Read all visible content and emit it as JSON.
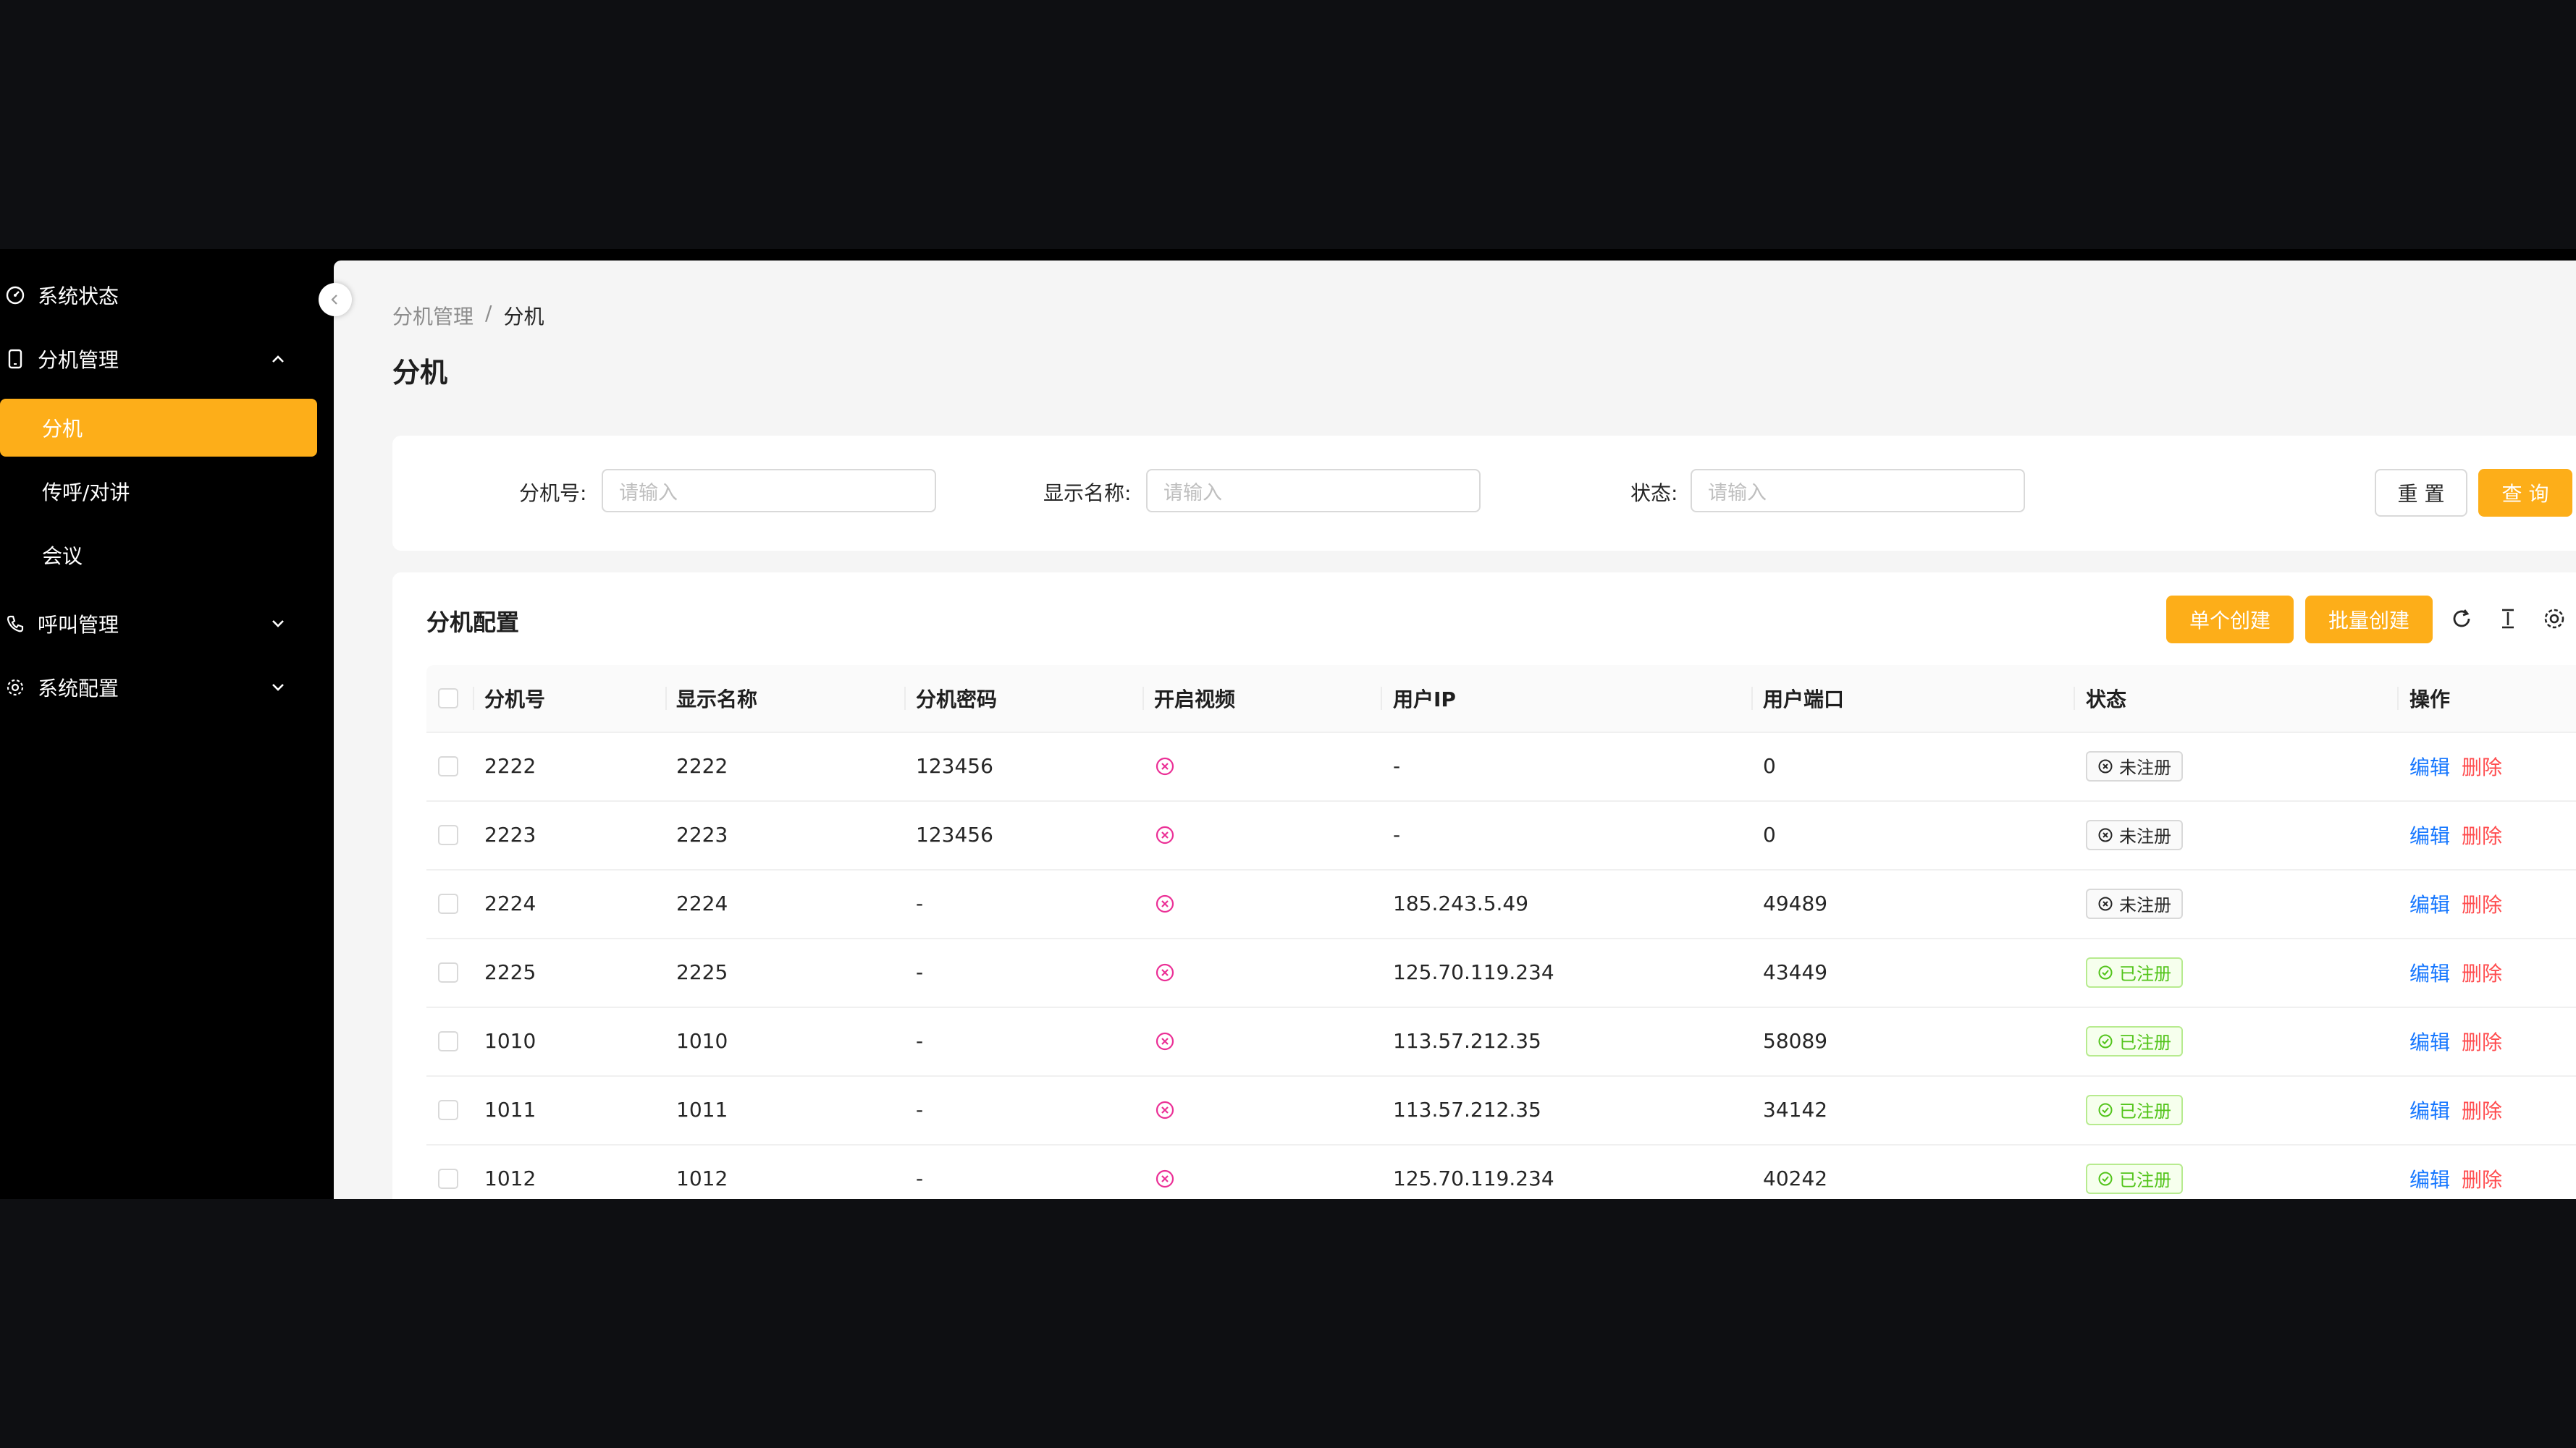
{
  "sidebar": {
    "items": [
      {
        "label": "系统状态",
        "icon": "dashboard-icon"
      },
      {
        "label": "分机管理",
        "icon": "phone-icon",
        "expanded": true,
        "children": [
          {
            "label": "分机",
            "active": true
          },
          {
            "label": "传呼/对讲"
          },
          {
            "label": "会议"
          }
        ]
      },
      {
        "label": "呼叫管理",
        "icon": "call-icon",
        "expanded": false
      },
      {
        "label": "系统配置",
        "icon": "gear-icon",
        "expanded": false
      }
    ]
  },
  "breadcrumb": {
    "parent": "分机管理",
    "separator": "/",
    "current": "分机"
  },
  "page_title": "分机",
  "filters": {
    "ext": {
      "label": "分机号:",
      "placeholder": "请输入"
    },
    "name": {
      "label": "显示名称:",
      "placeholder": "请输入"
    },
    "status": {
      "label": "状态:",
      "placeholder": "请输入"
    },
    "reset_label": "重 置",
    "query_label": "查 询"
  },
  "table": {
    "title": "分机配置",
    "create_single_label": "单个创建",
    "create_batch_label": "批量创建",
    "columns": [
      "分机号",
      "显示名称",
      "分机密码",
      "开启视频",
      "用户IP",
      "用户端口",
      "状态",
      "操作"
    ],
    "edit_label": "编辑",
    "delete_label": "删除",
    "rows": [
      {
        "ext": "2222",
        "name": "2222",
        "password": "123456",
        "video": false,
        "ip": "-",
        "port": "0",
        "status": "未注册",
        "registered": false
      },
      {
        "ext": "2223",
        "name": "2223",
        "password": "123456",
        "video": false,
        "ip": "-",
        "port": "0",
        "status": "未注册",
        "registered": false
      },
      {
        "ext": "2224",
        "name": "2224",
        "password": "-",
        "video": false,
        "ip": "185.243.5.49",
        "port": "49489",
        "status": "未注册",
        "registered": false
      },
      {
        "ext": "2225",
        "name": "2225",
        "password": "-",
        "video": false,
        "ip": "125.70.119.234",
        "port": "43449",
        "status": "已注册",
        "registered": true
      },
      {
        "ext": "1010",
        "name": "1010",
        "password": "-",
        "video": false,
        "ip": "113.57.212.35",
        "port": "58089",
        "status": "已注册",
        "registered": true
      },
      {
        "ext": "1011",
        "name": "1011",
        "password": "-",
        "video": false,
        "ip": "113.57.212.35",
        "port": "34142",
        "status": "已注册",
        "registered": true
      },
      {
        "ext": "1012",
        "name": "1012",
        "password": "-",
        "video": false,
        "ip": "125.70.119.234",
        "port": "40242",
        "status": "已注册",
        "registered": true
      }
    ]
  },
  "colors": {
    "primary": "#fdae19",
    "link": "#1677ff",
    "danger": "#ff4d4f",
    "success": "#52c41a",
    "video_off": "#eb2f96"
  }
}
